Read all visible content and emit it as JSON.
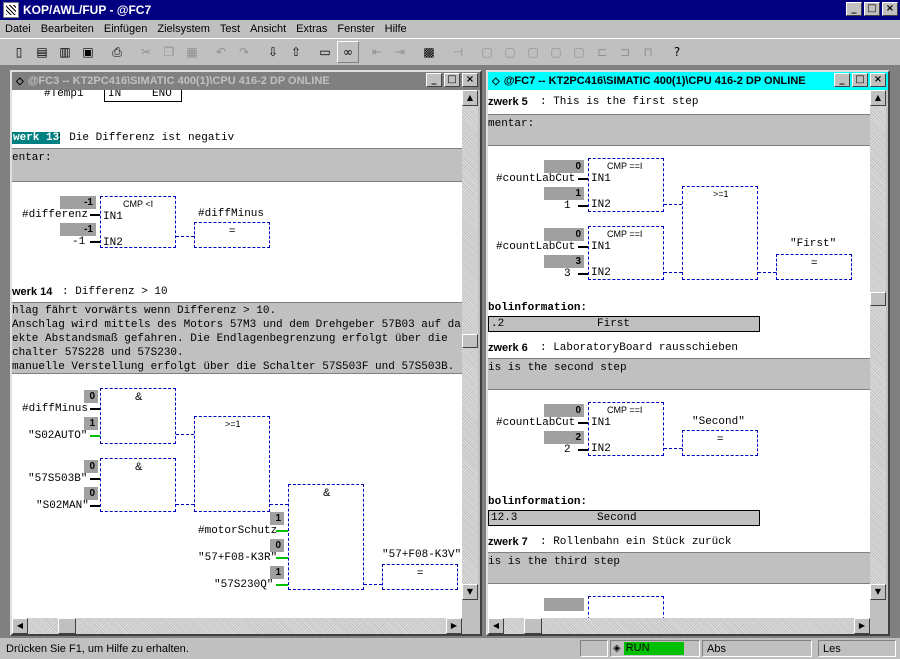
{
  "app": {
    "title": "KOP/AWL/FUP  - @FC7"
  },
  "menu": [
    "Datei",
    "Bearbeiten",
    "Einfügen",
    "Zielsystem",
    "Test",
    "Ansicht",
    "Extras",
    "Fenster",
    "Hilfe"
  ],
  "left_window": {
    "title": "@FC3 -- KT2PC416\\SIMATIC 400(1)\\CPU 416-2 DP  ONLINE",
    "top_fragment": "#Temp1",
    "top_fragment_in": "IN",
    "top_fragment_eno": "ENO",
    "n13_label": "werk 13",
    "n13_title": ": Die Differenz ist negativ",
    "n13_comment": "entar:",
    "n13_cmp": "CMP <I",
    "n13_in1_var": "#differenz",
    "n13_in1_val": "-1",
    "n13_in1_pin": "IN1",
    "n13_in2_val": "-1",
    "n13_in2_const": "-1",
    "n13_in2_pin": "IN2",
    "n13_out_var": "#diffMinus",
    "n13_out_sym": "=",
    "n14_label": "werk 14",
    "n14_title": ": Differenz > 10",
    "n14_comment": [
      "hlag fährt vorwärts wenn Differenz > 10.",
      "Anschlag wird mittels des Motors 57M3 und dem Drehgeber 57B03 auf das",
      "ekte Abstandsmaß gefahren. Die Endlagenbegrenzung erfolgt über die",
      "chalter 57S228 und 57S230.",
      "manuelle Verstellung erfolgt über die Schalter 57S503F und 57S503B."
    ],
    "and1": "&",
    "or1": ">=1",
    "and2": "&",
    "and3": "&",
    "v_diffMinus": "#diffMinus",
    "v_diffMinus_val": "0",
    "v_s02auto": "\"S02AUTO\"",
    "v_s02auto_val": "1",
    "v_57s503b": "\"57S503B\"",
    "v_57s503b_val": "0",
    "v_s02man": "\"S02MAN\"",
    "v_s02man_val": "0",
    "v_motor": "#motorSchutz",
    "v_motor_val": "1",
    "v_k3r": "\"57+F08-K3R\"",
    "v_k3r_val": "0",
    "v_57s230q": "\"57S230Q\"",
    "v_57s230q_val": "1",
    "out_k3v": "\"57+F08-K3V\"",
    "out_k3v_sym": "="
  },
  "right_window": {
    "title": "@FC7 -- KT2PC416\\SIMATIC 400(1)\\CPU 416-2 DP  ONLINE",
    "n5_label": "zwerk 5",
    "n5_title": ": This is the first step",
    "n5_comment": "mentar:",
    "cmp_a": "CMP ==I",
    "in1": "IN1",
    "in2": "IN2",
    "var_count": "#countLabCut",
    "n5_a_in1_val": "0",
    "n5_a_in2_val": "1",
    "n5_a_in2_const": "1",
    "n5_or": ">=1",
    "n5_b_in1_val": "0",
    "n5_b_in2_val": "3",
    "n5_b_in2_const": "3",
    "n5_out": "\"First\"",
    "n5_out_sym": "=",
    "sym_label": "bolinformation:",
    "n5_sym_addr": ".2",
    "n5_sym_name": "First",
    "n6_label": "zwerk 6",
    "n6_title": ": LaboratoryBoard rausschieben",
    "n6_comment": "is is the second step",
    "n6_in1_val": "0",
    "n6_in2_val": "2",
    "n6_in2_const": "2",
    "n6_out": "\"Second\"",
    "n6_out_sym": "=",
    "n6_sym_addr": "12.3",
    "n6_sym_name": "Second",
    "n7_label": "zwerk 7",
    "n7_title": ": Rollenbahn ein Stück zurück",
    "n7_comment": "is is the third step"
  },
  "status": {
    "help": "Drücken Sie F1, um Hilfe zu erhalten.",
    "run": "RUN",
    "abs": "Abs",
    "les": "Les"
  },
  "colors": {
    "active_title": "#00ffff",
    "inactive_title": "#808080",
    "run": "#00c000",
    "wire": "#0000c0"
  }
}
